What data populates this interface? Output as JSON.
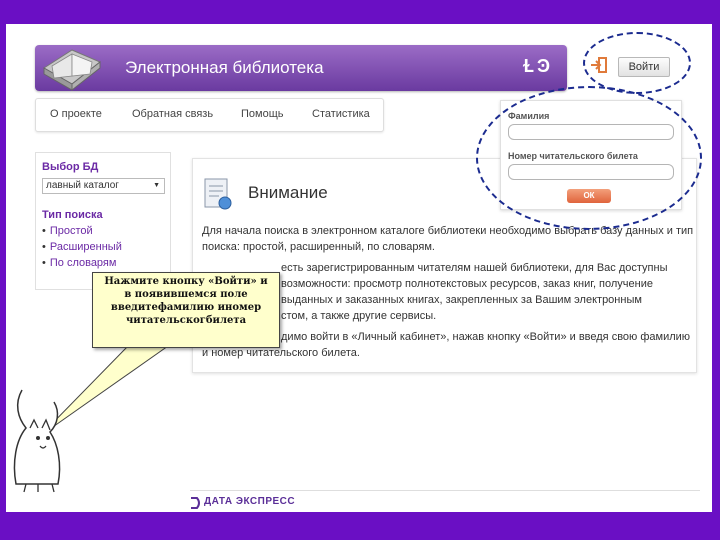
{
  "header": {
    "title": "Электронная библиотека",
    "logo": "Ɫ Ͽ"
  },
  "login": {
    "button_label": "Войти"
  },
  "nav": {
    "items": [
      "О проекте",
      "Обратная связь",
      "Помощь",
      "Статистика"
    ]
  },
  "db_panel": {
    "title": "Выбор БД",
    "selected": "лавный каталог",
    "search_type_title": "Тип поиска",
    "search_types": [
      "Простой",
      "Расширенный",
      "По словарям"
    ]
  },
  "content": {
    "heading": "Внимание",
    "lines": [
      "Для начала поиска в электронном каталоге библиотеки необходимо выбрать базу данных и тип",
      "поиска: простой, расширенный, по словарям.",
      "есть зарегистрированным читателям нашей библиотеки, для Вас доступны",
      "возможности: просмотр полнотекстовых ресурсов, заказ книг, получение",
      "выданных и заказанных книгах, закрепленных за Вашим электронным",
      "стом, а также другие сервисы.",
      "димо войти в «Личный кабинет», нажав кнопку «Войти» и введя свою фамилию",
      "и номер читательского билета."
    ]
  },
  "login_form": {
    "surname_label": "Фамилия",
    "card_label": "Номер читательского билета",
    "ok_label": "ОК"
  },
  "callout": {
    "text": "Нажмите кнопку «Войти» и\nв появившемся поле\nвведитефамилию иномер\nчитательскогбилета"
  },
  "footer": {
    "logo_text": "ДАТА ЭКСПРЕСС"
  },
  "colors": {
    "background": "#6a0fc4",
    "header": "#7a47b0",
    "accent": "#6b2aa5",
    "ellipse": "#1b2b8f",
    "callout": "#ffffcc"
  }
}
